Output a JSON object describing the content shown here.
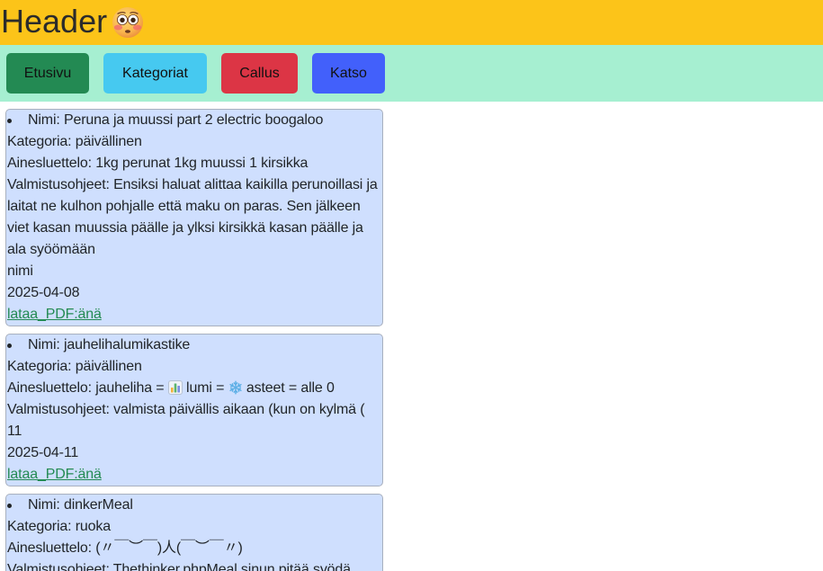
{
  "header": {
    "title": "Header",
    "emoji_icon": "flushed-face-icon"
  },
  "colors": {
    "header_bg": "#fcc419",
    "nav_bg": "#a6efd1",
    "card_bg": "#cfdffe",
    "link": "#238a53"
  },
  "nav": {
    "buttons": [
      {
        "label": "Etusivu",
        "color": "#238a53"
      },
      {
        "label": "Kategoriat",
        "color": "#46c9f0"
      },
      {
        "label": "Callus",
        "color": "#dc3545"
      },
      {
        "label": "Katso",
        "color": "#4260fb"
      }
    ]
  },
  "recipes": [
    {
      "name": "Nimi: Peruna ja muussi part 2 electric boogaloo",
      "category": "Kategoria: päivällinen",
      "ingredients": "Ainesluettelo: 1kg perunat 1kg muussi 1 kirsikka",
      "instructions": "Valmistusohjeet: Ensiksi haluat alittaa kaikilla perunoillasi ja laitat ne kulhon pohjalle että maku on paras. Sen jälkeen viet kasan muussia päälle ja ylksi kirsikkä kasan päälle ja ala syöömään",
      "author": "nimi",
      "date": "2025-04-08",
      "pdf_link": "lataa_PDF:änä"
    },
    {
      "name": "Nimi: jauhelihalumikastike",
      "category": "Kategoria: päivällinen",
      "ingredients": {
        "parts": [
          "Ainesluettelo: jauheliha = ",
          " lumi = ",
          " asteet = alle 0"
        ],
        "icons": [
          "bar-chart-icon",
          "snowflake-icon"
        ]
      },
      "instructions": "Valmistusohjeet: valmista päivällis aikaan (kun on kylmä (",
      "author": "11",
      "date": "2025-04-11",
      "pdf_link": "lataa_PDF:änä"
    },
    {
      "name": "Nimi: dinkerMeal",
      "category": "Kategoria: ruoka",
      "ingredients": "Ainesluettelo: (〃￣︶￣)人(￣︶￣〃)",
      "instructions": "Valmistusohjeet: Thethinker.phpMeal sinun pitää syödä"
    }
  ]
}
